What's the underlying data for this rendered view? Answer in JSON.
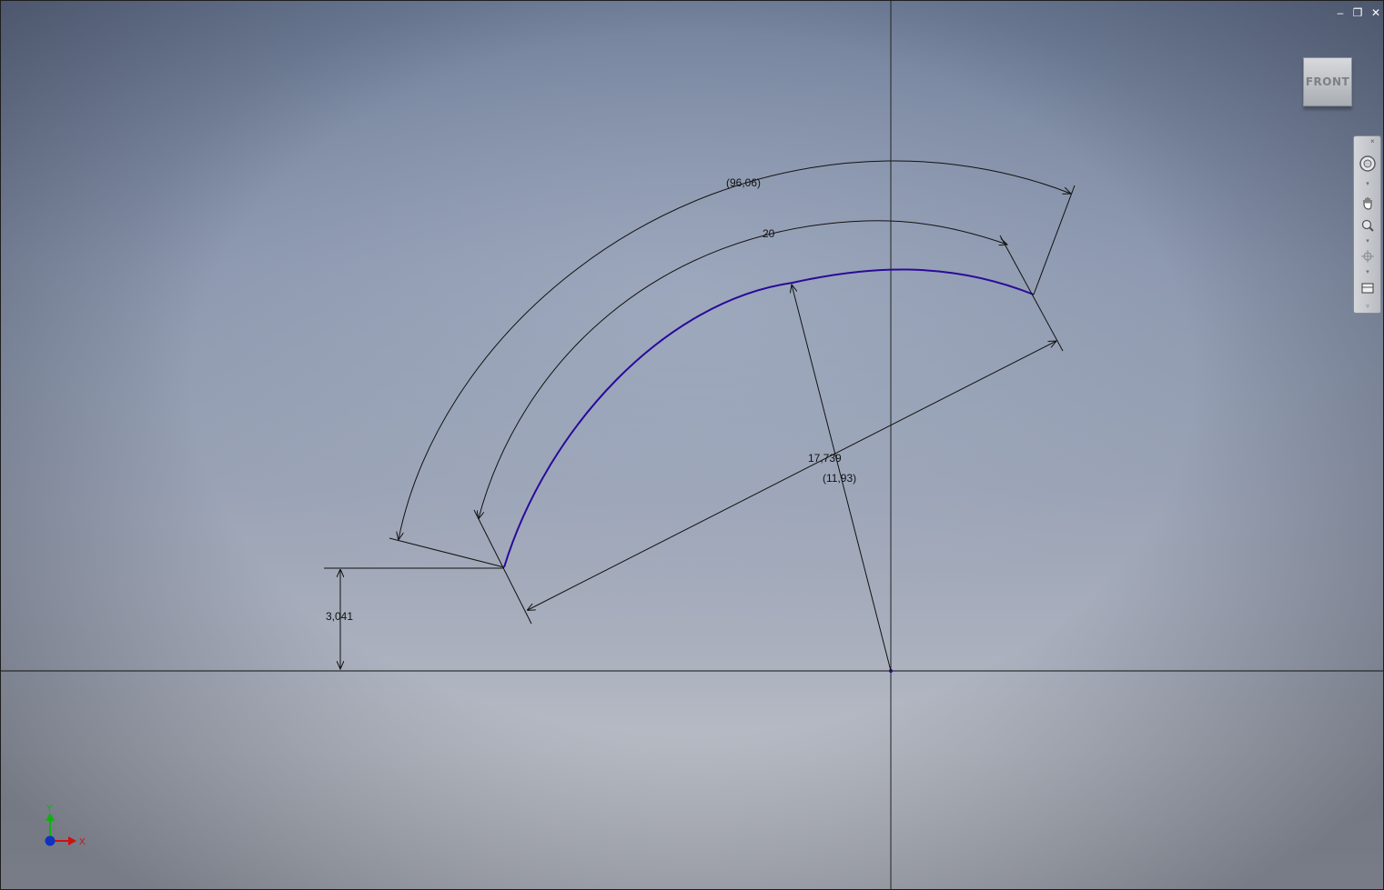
{
  "window_controls": {
    "minimize": "–",
    "restore": "❐",
    "close": "✕"
  },
  "viewcube": {
    "face_label": "FRONT"
  },
  "navigation_bar": {
    "tools": [
      "full-navigation-wheel",
      "pan",
      "zoom",
      "orbit",
      "look-at"
    ]
  },
  "sketch": {
    "dimensions": {
      "arc_outer_reference": "(96,06)",
      "arc_length": "20",
      "radius": "17,739",
      "chord_reference": "(11,93)",
      "vertical_offset": "3,041"
    },
    "colors": {
      "arc": "#2a0a9a",
      "dimension": "#111111",
      "axis": "#111111"
    }
  },
  "triad": {
    "x_label": "X",
    "y_label": "Y",
    "x_color": "#d01010",
    "y_color": "#10b010",
    "origin_color": "#1030c0"
  }
}
